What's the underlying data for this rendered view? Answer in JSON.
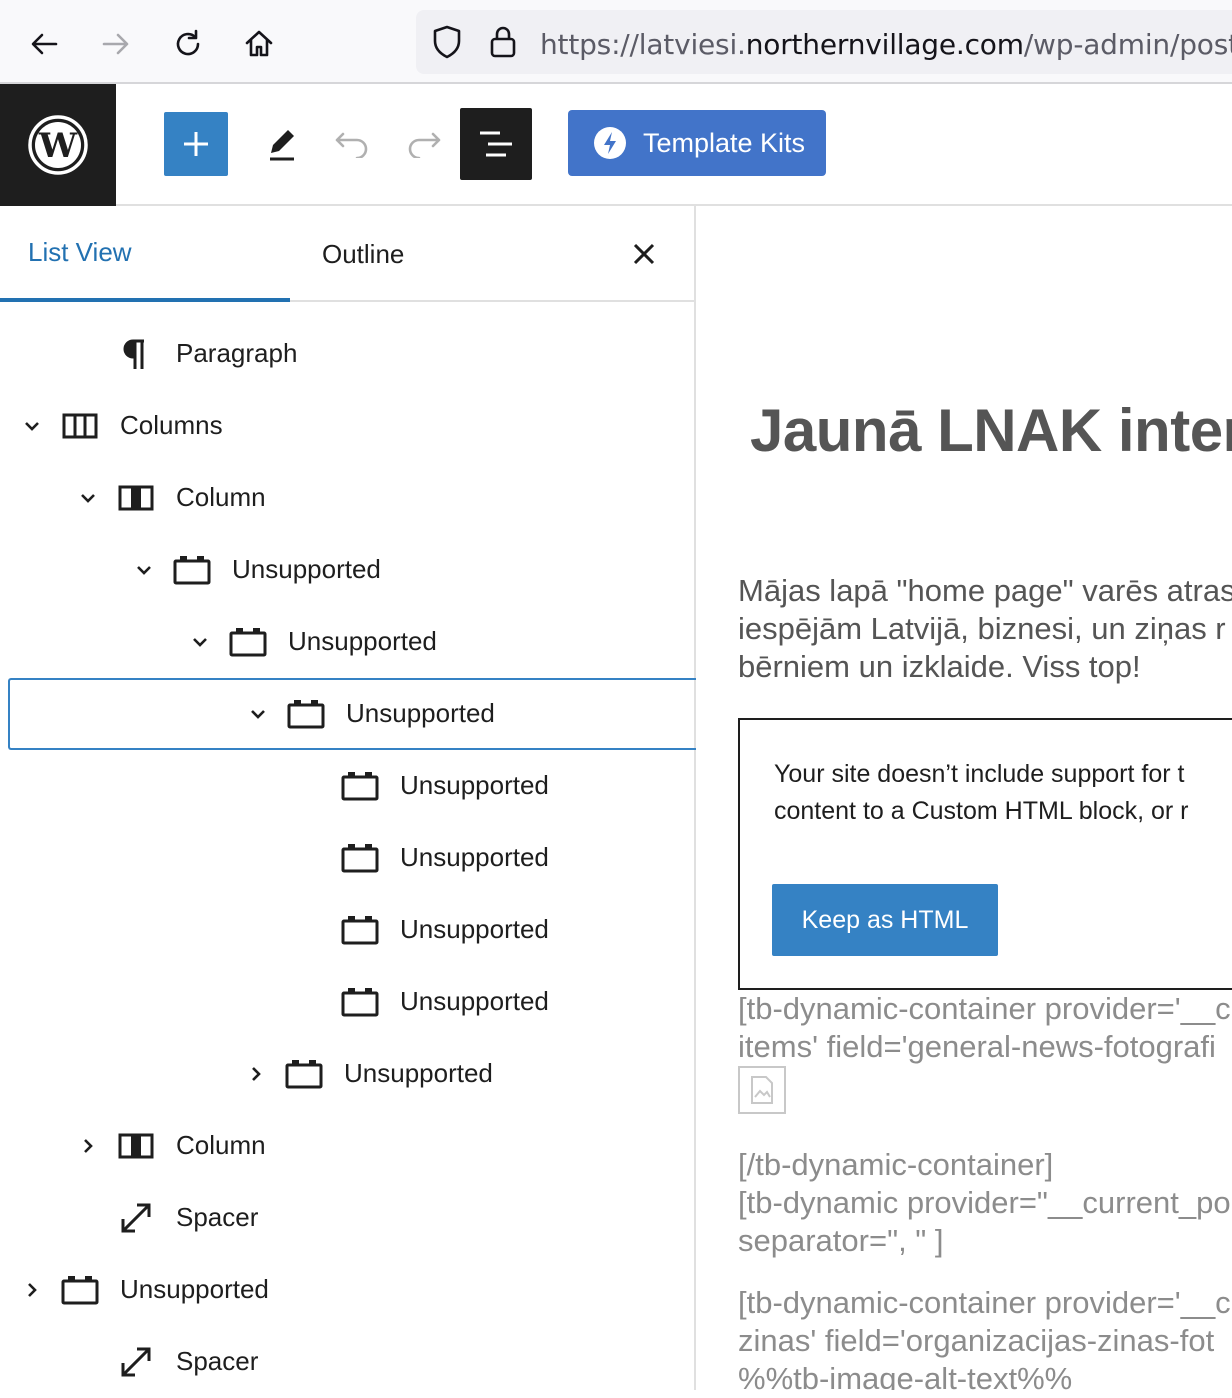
{
  "browser": {
    "url_prefix": "https://latviesi.",
    "url_domain": "northernvillage.com",
    "url_path": "/wp-admin/post.ph",
    "icons": [
      "back-arrow-icon",
      "forward-arrow-icon",
      "reload-icon",
      "home-icon",
      "shield-icon",
      "lock-icon"
    ]
  },
  "toolbar": {
    "template_kits_label": "Template Kits",
    "accent": "#3582c4",
    "kits_color": "#4274c9"
  },
  "sidebar": {
    "tabs": [
      {
        "label": "List View",
        "active": true
      },
      {
        "label": "Outline",
        "active": false
      }
    ],
    "items": [
      {
        "label": "Paragraph",
        "icon": "paragraph-icon",
        "expander": "none"
      },
      {
        "label": "Columns",
        "icon": "columns-icon",
        "expander": "expanded"
      },
      {
        "label": "Column",
        "icon": "column-icon",
        "expander": "expanded"
      },
      {
        "label": "Unsupported",
        "icon": "unsupported-block-icon",
        "expander": "expanded"
      },
      {
        "label": "Unsupported",
        "icon": "unsupported-block-icon",
        "expander": "expanded"
      },
      {
        "label": "Unsupported",
        "icon": "unsupported-block-icon",
        "expander": "expanded",
        "selected": true
      },
      {
        "label": "Unsupported",
        "icon": "unsupported-block-icon",
        "expander": "none"
      },
      {
        "label": "Unsupported",
        "icon": "unsupported-block-icon",
        "expander": "none"
      },
      {
        "label": "Unsupported",
        "icon": "unsupported-block-icon",
        "expander": "none"
      },
      {
        "label": "Unsupported",
        "icon": "unsupported-block-icon",
        "expander": "none"
      },
      {
        "label": "Unsupported",
        "icon": "unsupported-block-icon",
        "expander": "collapsed"
      },
      {
        "label": "Column",
        "icon": "column-icon",
        "expander": "collapsed"
      },
      {
        "label": "Spacer",
        "icon": "spacer-icon",
        "expander": "none"
      },
      {
        "label": "Unsupported",
        "icon": "unsupported-block-icon",
        "expander": "collapsed"
      },
      {
        "label": "Spacer",
        "icon": "spacer-icon",
        "expander": "none"
      }
    ]
  },
  "canvas": {
    "heading": "Jaunā LNAK intern",
    "paragraph_lines": [
      "Mājas lapā \"home page\" varēs atras",
      "iespējām Latvijā, biznesi, un ziņas r",
      "bērniem un izklaide. Viss top!"
    ],
    "warning_lines": [
      "Your site doesn’t include support for t",
      "content to a Custom HTML block, or r"
    ],
    "keep_html_label": "Keep as HTML",
    "shortcode_1": [
      "[tb-dynamic-container provider='__c",
      "items' field='general-news-fotografi"
    ],
    "shortcode_2": [
      "[/tb-dynamic-container]",
      "[tb-dynamic provider=\"__current_po",
      "separator=\", \" ]"
    ],
    "shortcode_3": [
      "[tb-dynamic-container provider='__c",
      "zinas' field='organizacijas-zinas-fot",
      "%%tb-image-alt-text%%"
    ]
  }
}
